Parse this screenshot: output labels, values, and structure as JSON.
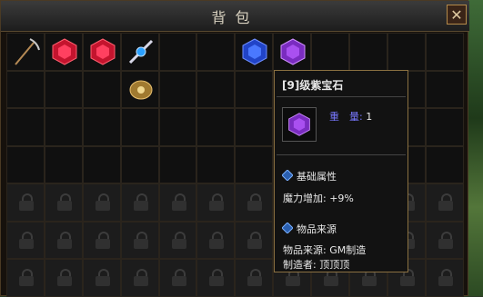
{
  "window": {
    "title": "背包",
    "close_glyph": "✕"
  },
  "slots": {
    "row1": [
      "pickaxe-icon",
      "red-gem-icon",
      "red-gem-icon",
      "blue-gem-wand-icon",
      "",
      "",
      "blue-gem-icon",
      "purple-gem-icon",
      "",
      "",
      "",
      ""
    ],
    "row2": [
      "",
      "",
      "",
      "gold-ornament-icon",
      "",
      "",
      "",
      "",
      "",
      "",
      "",
      ""
    ]
  },
  "tooltip": {
    "name": "[9]级紫宝石",
    "weight_label": "重　量:",
    "weight_value": "1",
    "section_basic": "基础属性",
    "attr_label": "魔力增加:",
    "attr_value": "+9%",
    "section_source": "物品来源",
    "source_line": "物品来源: GM制造",
    "maker_line": "制造者: 顶顶顶"
  },
  "colors": {
    "accent": "#8a7040",
    "weight_label": "#7878ff",
    "purple_gem": "#8a3fd0",
    "red_gem": "#d0203a",
    "blue_gem": "#2f5fe0"
  }
}
